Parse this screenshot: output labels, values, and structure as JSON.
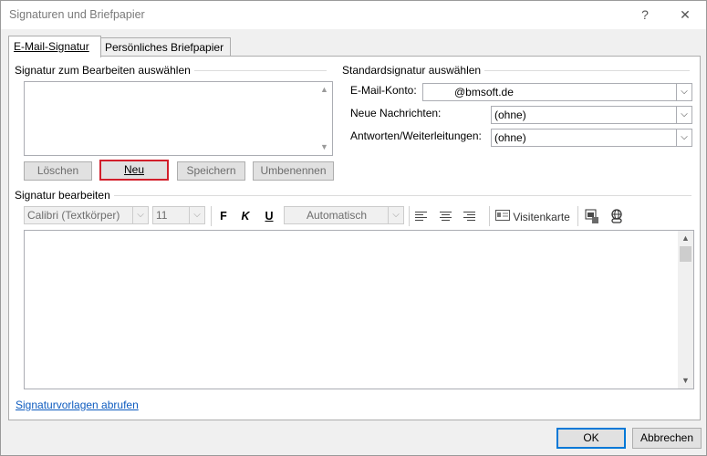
{
  "window": {
    "title": "Signaturen und Briefpapier",
    "help": "?",
    "close": "✕"
  },
  "tabs": [
    {
      "label": "E-Mail-Signatur"
    },
    {
      "label": "Persönliches Briefpapier"
    }
  ],
  "select_section": {
    "label": "Signatur zum Bearbeiten auswählen"
  },
  "buttons": {
    "delete": "Löschen",
    "new": "Neu",
    "save": "Speichern",
    "rename": "Umbenennen"
  },
  "default_section": {
    "label": "Standardsignatur auswählen",
    "account_label": "E-Mail-Konto:",
    "account_value": "@bmsoft.de",
    "new_messages_label": "Neue Nachrichten:",
    "new_messages_value": "(ohne)",
    "replies_label": "Antworten/Weiterleitungen:",
    "replies_value": "(ohne)"
  },
  "edit_section": {
    "label": "Signatur bearbeiten",
    "font": "Calibri (Textkörper)",
    "size": "11",
    "bold": "F",
    "italic": "K",
    "underline": "U",
    "color": "Automatisch",
    "business_card": "Visitenkarte"
  },
  "templates_link": "Signaturvorlagen abrufen",
  "footer": {
    "ok": "OK",
    "cancel": "Abbrechen"
  }
}
